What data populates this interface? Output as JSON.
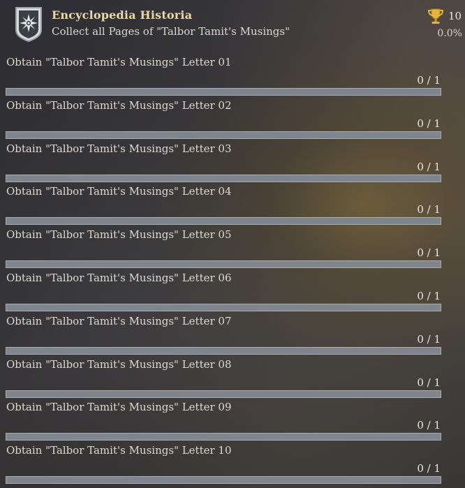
{
  "header": {
    "badge_icon": "shield-compass-icon",
    "title": "Encyclopedia Historia",
    "subtitle": "Collect all Pages of \"Talbor Tamit's Musings\"",
    "trophy_icon": "trophy-icon",
    "points": "10",
    "percent": "0.0%"
  },
  "colors": {
    "title": "#e9d9a8",
    "progress_track": "#7e858c",
    "progress_fill": "#c9a850"
  },
  "tasks": [
    {
      "label": "Obtain \"Talbor Tamit's Musings\" Letter 01",
      "count": "0 / 1",
      "progress": 0
    },
    {
      "label": "Obtain \"Talbor Tamit's Musings\" Letter 02",
      "count": "0 / 1",
      "progress": 0
    },
    {
      "label": "Obtain \"Talbor Tamit's Musings\" Letter 03",
      "count": "0 / 1",
      "progress": 0
    },
    {
      "label": "Obtain \"Talbor Tamit's Musings\" Letter 04",
      "count": "0 / 1",
      "progress": 0
    },
    {
      "label": "Obtain \"Talbor Tamit's Musings\" Letter 05",
      "count": "0 / 1",
      "progress": 0
    },
    {
      "label": "Obtain \"Talbor Tamit's Musings\" Letter 06",
      "count": "0 / 1",
      "progress": 0
    },
    {
      "label": "Obtain \"Talbor Tamit's Musings\" Letter 07",
      "count": "0 / 1",
      "progress": 0
    },
    {
      "label": "Obtain \"Talbor Tamit's Musings\" Letter 08",
      "count": "0 / 1",
      "progress": 0
    },
    {
      "label": "Obtain \"Talbor Tamit's Musings\" Letter 09",
      "count": "0 / 1",
      "progress": 0
    },
    {
      "label": "Obtain \"Talbor Tamit's Musings\" Letter 10",
      "count": "0 / 1",
      "progress": 0
    }
  ]
}
